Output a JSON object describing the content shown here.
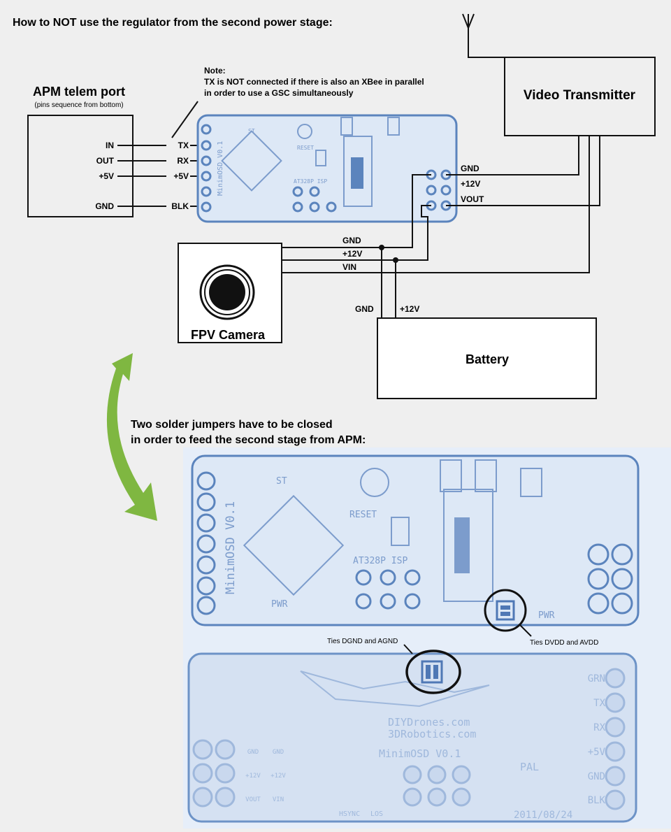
{
  "title": "How to NOT use the regulator from the second power stage:",
  "note": {
    "heading": "Note:",
    "line1": "TX is NOT connected if there is also an XBee in parallel",
    "line2": "in order to use a GSC simultaneously"
  },
  "apm": {
    "title": "APM telem port",
    "subtitle": "(pins sequence from bottom)",
    "pins": [
      "IN",
      "OUT",
      "+5V",
      "GND"
    ]
  },
  "osd_pins_left": [
    "TX",
    "RX",
    "+5V",
    "BLK"
  ],
  "osd_pins_right": [
    "GND",
    "+12V",
    "VOUT"
  ],
  "video_transmitter": "Video Transmitter",
  "camera": {
    "label": "FPV Camera",
    "wires": [
      "GND",
      "+12V",
      "VIN"
    ]
  },
  "battery": {
    "label": "Battery",
    "wires": [
      "GND",
      "+12V"
    ]
  },
  "jumper_text": {
    "line1": "Two solder jumpers have to be closed",
    "line2": "in order to feed the second stage from APM:"
  },
  "board_top": {
    "labels": [
      "ST",
      "RESET",
      "AT328P ISP",
      "MinimOSD V0.1",
      "PWR",
      "PWR"
    ]
  },
  "callouts": {
    "dgnd": "Ties DGND and AGND",
    "dvdd": "Ties DVDD and AVDD"
  },
  "board_bottom": {
    "labels": [
      "DIYDrones.com",
      "3DRobotics.com",
      "MinimOSD V0.1",
      "PAL",
      "HSYNC",
      "LOS",
      "2011/08/24"
    ],
    "pins_right": [
      "GRN",
      "TX",
      "RX",
      "+5V",
      "GND",
      "BLK"
    ],
    "pads_left": [
      "GND",
      "GND",
      "+12V",
      "+12V",
      "VOUT",
      "VIN"
    ]
  },
  "colors": {
    "pcb": "#5b84bd",
    "arrow": "#7fb741",
    "panel": "#e6eef9"
  }
}
